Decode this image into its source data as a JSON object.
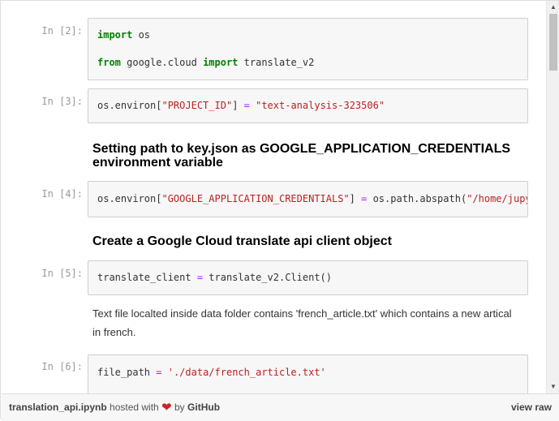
{
  "cells": [
    {
      "prompt": "In [2]:",
      "lines": [
        [
          {
            "t": "import",
            "c": "kw"
          },
          {
            "t": " os"
          }
        ],
        [],
        [
          {
            "t": "from",
            "c": "kw"
          },
          {
            "t": " google.cloud "
          },
          {
            "t": "import",
            "c": "kw"
          },
          {
            "t": " translate_v2"
          }
        ]
      ]
    },
    {
      "prompt": "In [3]:",
      "lines": [
        [
          {
            "t": "os.environ["
          },
          {
            "t": "\"PROJECT_ID\"",
            "c": "str"
          },
          {
            "t": "] "
          },
          {
            "t": "=",
            "c": "op"
          },
          {
            "t": " "
          },
          {
            "t": "\"text-analysis-323506\"",
            "c": "str"
          }
        ]
      ]
    },
    {
      "prompt": "In [4]:",
      "lines": [
        [
          {
            "t": "os.environ["
          },
          {
            "t": "\"GOOGLE_APPLICATION_CREDENTIALS\"",
            "c": "str"
          },
          {
            "t": "] "
          },
          {
            "t": "=",
            "c": "op"
          },
          {
            "t": " os.path.abspath("
          },
          {
            "t": "\"/home/jupyter",
            "c": "str"
          }
        ]
      ]
    },
    {
      "prompt": "In [5]:",
      "lines": [
        [
          {
            "t": "translate_client "
          },
          {
            "t": "=",
            "c": "op"
          },
          {
            "t": " translate_v2.Client()"
          }
        ]
      ]
    },
    {
      "prompt": "In [6]:",
      "lines": [
        [
          {
            "t": "file_path "
          },
          {
            "t": "=",
            "c": "op"
          },
          {
            "t": " "
          },
          {
            "t": "'./data/french_article.txt'",
            "c": "str"
          }
        ]
      ]
    }
  ],
  "markdown": {
    "heading_credentials": "Setting path to key.json as GOOGLE_APPLICATION_CREDENTIALS environment variable",
    "heading_client": "Create a Google Cloud translate api client object",
    "paragraph_file": "Text file localted inside data folder contains 'french_article.txt' which contains a new artical in french."
  },
  "footer": {
    "filename": "translation_api.ipynb",
    "hosted_with": "hosted with",
    "by": "by",
    "github": "GitHub",
    "view_raw": "view raw"
  },
  "icons": {
    "heart": "heart-icon",
    "scroll_up": "chevron-up-icon",
    "scroll_down": "chevron-down-icon"
  },
  "colors": {
    "keyword": "#008000",
    "string": "#ba2121",
    "operator": "#aa22ff",
    "prompt": "#999999",
    "heart": "#cc2229"
  }
}
